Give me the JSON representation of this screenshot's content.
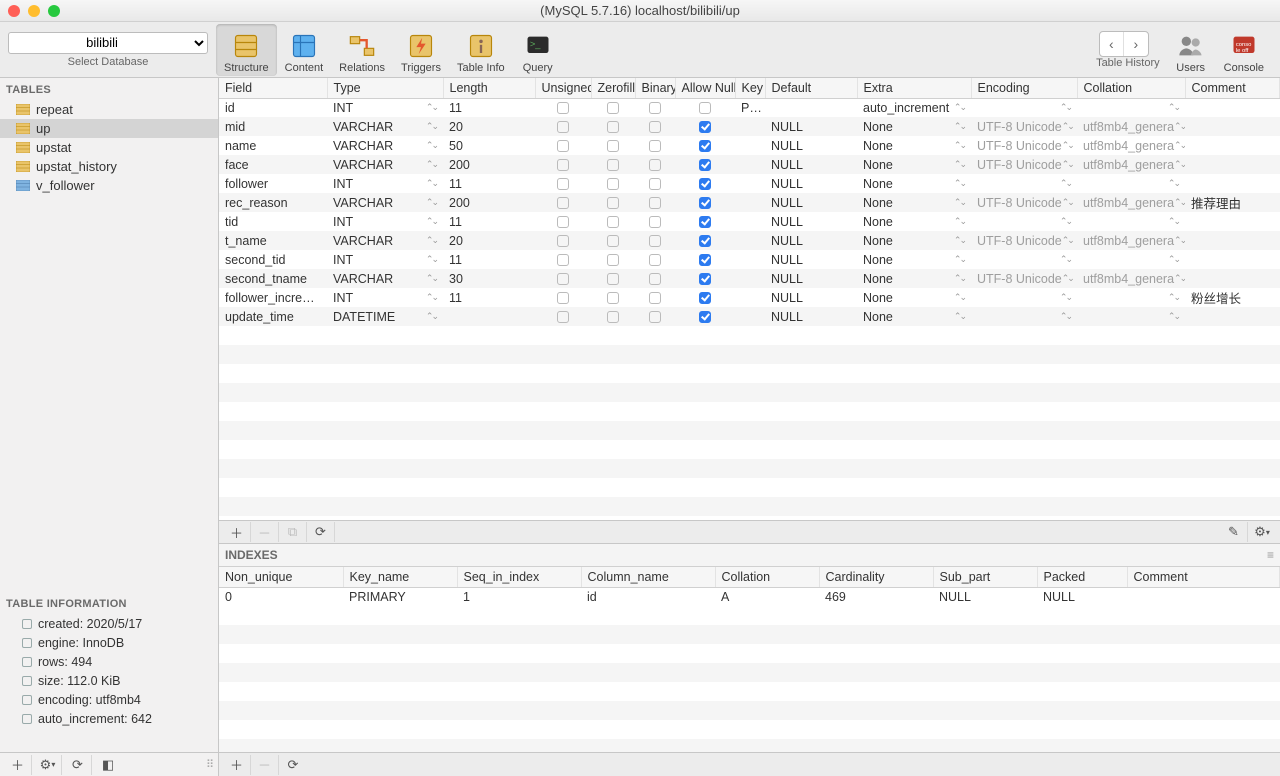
{
  "window_title": "(MySQL 5.7.16) localhost/bilibili/up",
  "db_selector": {
    "value": "bilibili",
    "label": "Select Database"
  },
  "toolbar": {
    "structure": "Structure",
    "content": "Content",
    "relations": "Relations",
    "triggers": "Triggers",
    "table_info": "Table Info",
    "query": "Query",
    "table_history": "Table History",
    "users": "Users",
    "console": "Console"
  },
  "sidebar": {
    "tables_header": "TABLES",
    "tables": [
      {
        "name": "repeat",
        "type": "table"
      },
      {
        "name": "up",
        "type": "table",
        "selected": true
      },
      {
        "name": "upstat",
        "type": "table"
      },
      {
        "name": "upstat_history",
        "type": "table"
      },
      {
        "name": "v_follower",
        "type": "view"
      }
    ],
    "info_header": "TABLE INFORMATION",
    "info": [
      "created: 2020/5/17",
      "engine: InnoDB",
      "rows: 494",
      "size: 112.0 KiB",
      "encoding: utf8mb4",
      "auto_increment: 642"
    ]
  },
  "columns_header": {
    "field": "Field",
    "type": "Type",
    "length": "Length",
    "unsigned": "Unsigned",
    "zerofill": "Zerofill",
    "binary": "Binary",
    "allow_null": "Allow Null",
    "key": "Key",
    "default": "Default",
    "extra": "Extra",
    "encoding": "Encoding",
    "collation": "Collation",
    "comment": "Comment"
  },
  "columns": [
    {
      "field": "id",
      "type": "INT",
      "length": "11",
      "unsigned": false,
      "zerofill": false,
      "binary": false,
      "allow_null": false,
      "key": "PRI",
      "default": "",
      "extra": "auto_increment",
      "encoding": "",
      "collation": "",
      "comment": ""
    },
    {
      "field": "mid",
      "type": "VARCHAR",
      "length": "20",
      "unsigned": false,
      "zerofill": false,
      "binary": false,
      "allow_null": true,
      "key": "",
      "default": "NULL",
      "extra": "None",
      "encoding": "UTF-8 Unicode",
      "collation": "utf8mb4_genera",
      "comment": ""
    },
    {
      "field": "name",
      "type": "VARCHAR",
      "length": "50",
      "unsigned": false,
      "zerofill": false,
      "binary": false,
      "allow_null": true,
      "key": "",
      "default": "NULL",
      "extra": "None",
      "encoding": "UTF-8 Unicode",
      "collation": "utf8mb4_genera",
      "comment": ""
    },
    {
      "field": "face",
      "type": "VARCHAR",
      "length": "200",
      "unsigned": false,
      "zerofill": false,
      "binary": false,
      "allow_null": true,
      "key": "",
      "default": "NULL",
      "extra": "None",
      "encoding": "UTF-8 Unicode",
      "collation": "utf8mb4_genera",
      "comment": ""
    },
    {
      "field": "follower",
      "type": "INT",
      "length": "11",
      "unsigned": false,
      "zerofill": false,
      "binary": false,
      "allow_null": true,
      "key": "",
      "default": "NULL",
      "extra": "None",
      "encoding": "",
      "collation": "",
      "comment": ""
    },
    {
      "field": "rec_reason",
      "type": "VARCHAR",
      "length": "200",
      "unsigned": false,
      "zerofill": false,
      "binary": false,
      "allow_null": true,
      "key": "",
      "default": "NULL",
      "extra": "None",
      "encoding": "UTF-8 Unicode",
      "collation": "utf8mb4_genera",
      "comment": "推荐理由"
    },
    {
      "field": "tid",
      "type": "INT",
      "length": "11",
      "unsigned": false,
      "zerofill": false,
      "binary": false,
      "allow_null": true,
      "key": "",
      "default": "NULL",
      "extra": "None",
      "encoding": "",
      "collation": "",
      "comment": ""
    },
    {
      "field": "t_name",
      "type": "VARCHAR",
      "length": "20",
      "unsigned": false,
      "zerofill": false,
      "binary": false,
      "allow_null": true,
      "key": "",
      "default": "NULL",
      "extra": "None",
      "encoding": "UTF-8 Unicode",
      "collation": "utf8mb4_genera",
      "comment": ""
    },
    {
      "field": "second_tid",
      "type": "INT",
      "length": "11",
      "unsigned": false,
      "zerofill": false,
      "binary": false,
      "allow_null": true,
      "key": "",
      "default": "NULL",
      "extra": "None",
      "encoding": "",
      "collation": "",
      "comment": ""
    },
    {
      "field": "second_tname",
      "type": "VARCHAR",
      "length": "30",
      "unsigned": false,
      "zerofill": false,
      "binary": false,
      "allow_null": true,
      "key": "",
      "default": "NULL",
      "extra": "None",
      "encoding": "UTF-8 Unicode",
      "collation": "utf8mb4_genera",
      "comment": ""
    },
    {
      "field": "follower_increase",
      "type": "INT",
      "length": "11",
      "unsigned": false,
      "zerofill": false,
      "binary": false,
      "allow_null": true,
      "key": "",
      "default": "NULL",
      "extra": "None",
      "encoding": "",
      "collation": "",
      "comment": "粉丝增长"
    },
    {
      "field": "update_time",
      "type": "DATETIME",
      "length": "",
      "unsigned": false,
      "zerofill": false,
      "binary": false,
      "allow_null": true,
      "key": "",
      "default": "NULL",
      "extra": "None",
      "encoding": "",
      "collation": "",
      "comment": ""
    }
  ],
  "indexes_header": "INDEXES",
  "idx_cols": {
    "non_unique": "Non_unique",
    "key_name": "Key_name",
    "seq": "Seq_in_index",
    "col": "Column_name",
    "collation": "Collation",
    "card": "Cardinality",
    "sub": "Sub_part",
    "packed": "Packed",
    "comment": "Comment"
  },
  "indexes": [
    {
      "non_unique": "0",
      "key_name": "PRIMARY",
      "seq": "1",
      "col": "id",
      "collation": "A",
      "card": "469",
      "sub": "NULL",
      "packed": "NULL",
      "comment": ""
    }
  ]
}
